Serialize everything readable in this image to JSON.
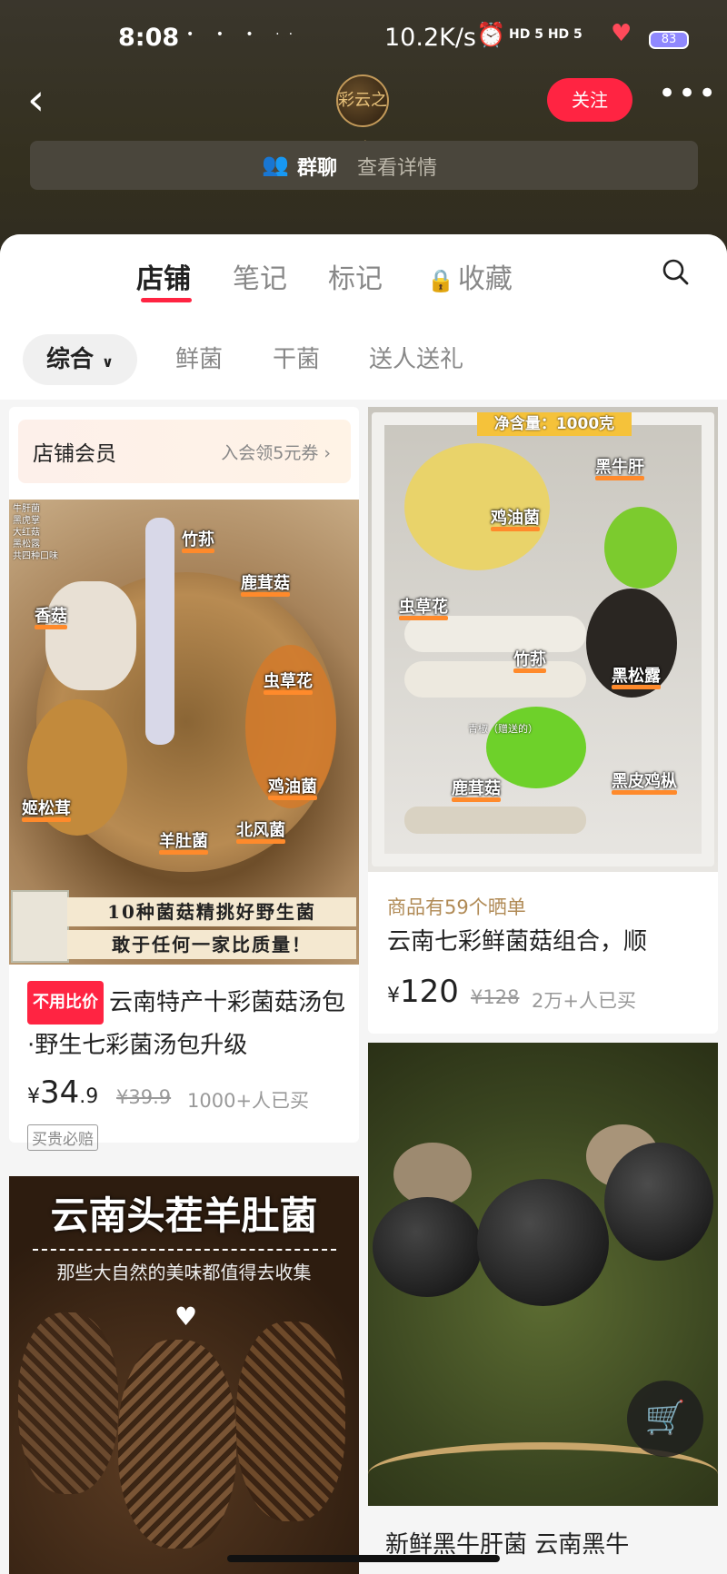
{
  "status": {
    "time": "8:08",
    "speed": "10.2K/s",
    "net": "HD 5 HD 5",
    "battery": "83"
  },
  "header": {
    "logo_text": "彩云之珍",
    "follow_label": "关注",
    "more_icon": "more-icon"
  },
  "group": {
    "label": "群聊",
    "detail": "查看详情"
  },
  "tabs": [
    {
      "label": "店铺"
    },
    {
      "label": "笔记"
    },
    {
      "label": "标记"
    },
    {
      "label": "收藏"
    }
  ],
  "filters": [
    {
      "label": "综合"
    },
    {
      "label": "鲜菌"
    },
    {
      "label": "干菌"
    },
    {
      "label": "送人送礼"
    }
  ],
  "member": {
    "title": "店铺会员",
    "link": "入会领5元券 ›"
  },
  "products": [
    {
      "image_labels": {
        "corner": "牛肝菌\n黑虎掌\n大红菇\n黑松露\n共四种口味",
        "tags": [
          "竹荪",
          "鹿茸菇",
          "香菇",
          "虫草花",
          "鸡油菌",
          "姬松茸",
          "北风菌",
          "羊肚菌"
        ],
        "banner1": "10种菌菇精挑好野生菌",
        "banner2": "敢于任何一家比质量！"
      },
      "badge": "不用比价",
      "title": "云南特产十彩菌菇汤包·野生七彩菌汤包升级",
      "price_int": "34",
      "price_dec": ".9",
      "old_price": "¥39.9",
      "sold": "1000+人已买",
      "guarantee": "买贵必赔"
    },
    {
      "image_labels": {
        "net": "净含量：1000克",
        "tags": [
          "黑牛肝",
          "鸡油菌",
          "虫草花",
          "竹荪",
          "黑松露",
          "鹿茸菇",
          "黑皮鸡枞"
        ],
        "small": "青椒（赠送的）"
      },
      "reviews": "商品有59个晒单",
      "title": "云南七彩鲜菌菇组合，顺",
      "price_int": "120",
      "old_price": "¥128",
      "sold": "2万+人已买"
    },
    {
      "image_title": "云南头茬羊肚菌",
      "image_sub": "那些大自然的美味都值得去收集"
    },
    {
      "caption": "新鲜黑牛肝菌 云南黑牛"
    }
  ],
  "currency": "¥",
  "colors": {
    "accent": "#ff2442",
    "header_bg": "#34301f"
  }
}
